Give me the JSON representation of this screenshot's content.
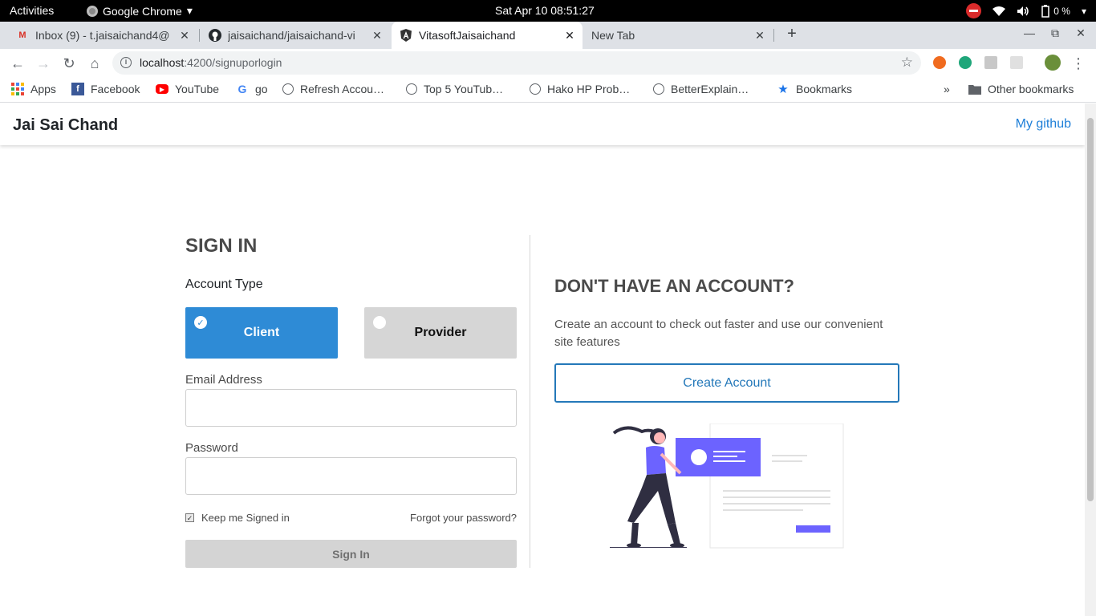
{
  "system_bar": {
    "activities": "Activities",
    "app_name": "Google Chrome",
    "clock": "Sat Apr 10  08:51:27",
    "battery": "0 %"
  },
  "tabs": [
    {
      "title": "Inbox (9) - t.jaisaichand4@",
      "icon": "gmail-icon",
      "active": false
    },
    {
      "title": "jaisaichand/jaisaichand-vi",
      "icon": "github-icon",
      "active": false
    },
    {
      "title": "VitasoftJaisaichand",
      "icon": "angular-icon",
      "active": true
    },
    {
      "title": "New Tab",
      "icon": "",
      "active": false
    }
  ],
  "address_bar": {
    "host": "localhost",
    "path": ":4200/signuporlogin"
  },
  "bookmarks": [
    {
      "label": "Apps",
      "icon": "apps-grid-icon"
    },
    {
      "label": "Facebook",
      "icon": "facebook-icon"
    },
    {
      "label": "YouTube",
      "icon": "youtube-icon"
    },
    {
      "label": "go",
      "icon": "google-icon"
    },
    {
      "label": "Refresh Accou…",
      "icon": "globe-icon"
    },
    {
      "label": "Top 5 YouTub…",
      "icon": "globe-icon"
    },
    {
      "label": "Hako HP Prob…",
      "icon": "globe-icon"
    },
    {
      "label": "BetterExplain…",
      "icon": "globe-icon"
    },
    {
      "label": "Bookmarks",
      "icon": "star-icon"
    }
  ],
  "other_bookmarks": "Other bookmarks",
  "site": {
    "brand": "Jai Sai Chand",
    "github_link": "My github"
  },
  "signin": {
    "title": "SIGN IN",
    "account_type_label": "Account Type",
    "option_client": "Client",
    "option_provider": "Provider",
    "selected_option": "Client",
    "email_label": "Email Address",
    "email_value": "",
    "password_label": "Password",
    "password_value": "",
    "keep_signed_in": "Keep me Signed in",
    "keep_signed_in_checked": true,
    "forgot_password": "Forgot your password?",
    "submit": "Sign In"
  },
  "register": {
    "title": "DON'T HAVE AN ACCOUNT?",
    "text": "Create an account to check out faster and use our convenient site features",
    "button": "Create Account"
  },
  "colors": {
    "primary": "#2e8bd6",
    "accent_purple": "#6c63ff",
    "link": "#1e7fd8"
  }
}
